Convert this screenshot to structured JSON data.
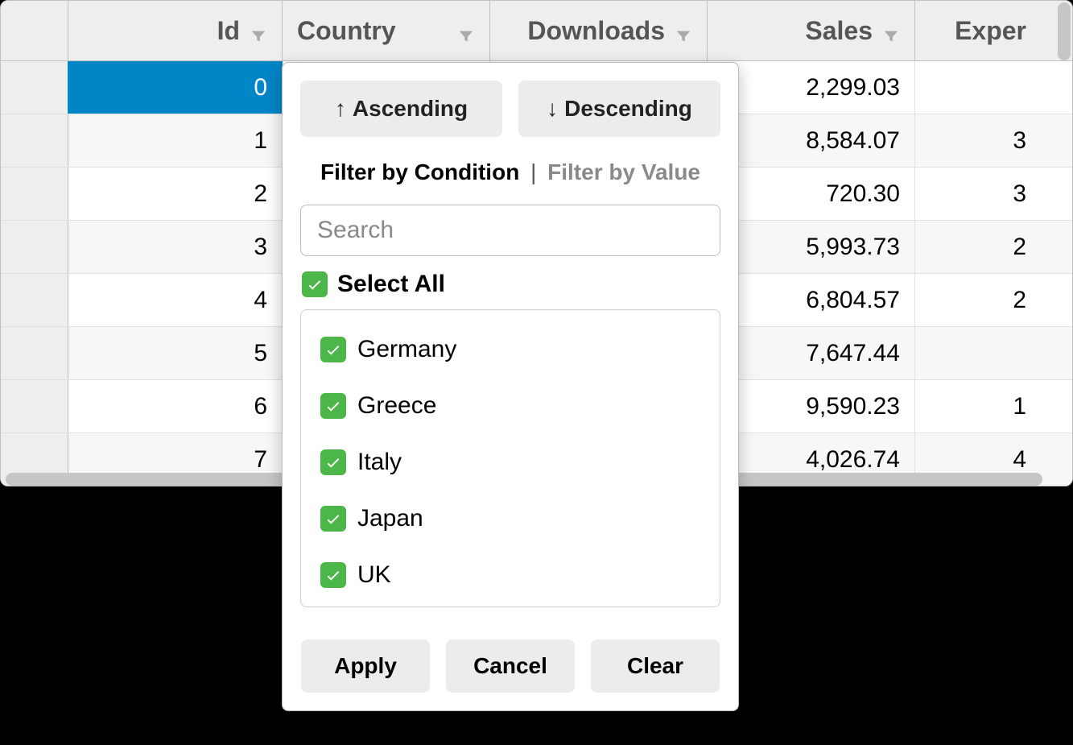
{
  "grid": {
    "columns": {
      "id": "Id",
      "country": "Country",
      "downloads": "Downloads",
      "sales": "Sales",
      "expenses": "Exper"
    },
    "rows": [
      {
        "id": "0",
        "sales": "2,299.03",
        "expenses": "",
        "selected": true
      },
      {
        "id": "1",
        "sales": "8,584.07",
        "expenses": "3",
        "selected": false
      },
      {
        "id": "2",
        "sales": "720.30",
        "expenses": "3",
        "selected": false
      },
      {
        "id": "3",
        "sales": "5,993.73",
        "expenses": "2",
        "selected": false
      },
      {
        "id": "4",
        "sales": "6,804.57",
        "expenses": "2",
        "selected": false
      },
      {
        "id": "5",
        "sales": "7,647.44",
        "expenses": "",
        "selected": false
      },
      {
        "id": "6",
        "sales": "9,590.23",
        "expenses": "1",
        "selected": false
      },
      {
        "id": "7",
        "sales": "4,026.74",
        "expenses": "4",
        "selected": false
      }
    ]
  },
  "panel": {
    "sort": {
      "asc": "Ascending",
      "desc": "Descending"
    },
    "tabs": {
      "condition": "Filter by Condition",
      "sep": "|",
      "value": "Filter by Value"
    },
    "search_placeholder": "Search",
    "select_all": "Select All",
    "values": [
      "Germany",
      "Greece",
      "Italy",
      "Japan",
      "UK"
    ],
    "buttons": {
      "apply": "Apply",
      "cancel": "Cancel",
      "clear": "Clear"
    }
  }
}
